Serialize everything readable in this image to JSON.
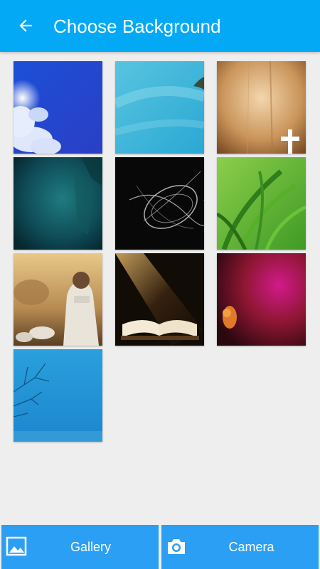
{
  "appbar": {
    "title": "Choose Background",
    "back_icon": "arrow-back-icon"
  },
  "backgrounds": [
    {
      "name": "background-blue-sky-clouds"
    },
    {
      "name": "background-turquoise-sky-bird"
    },
    {
      "name": "background-parchment-cross"
    },
    {
      "name": "background-teal-texture"
    },
    {
      "name": "background-black-light-swirls"
    },
    {
      "name": "background-green-grass"
    },
    {
      "name": "background-shepherd-painting"
    },
    {
      "name": "background-open-bible-light"
    },
    {
      "name": "background-magenta-red-texture"
    },
    {
      "name": "background-blue-tree"
    }
  ],
  "bottom_bar": {
    "gallery": {
      "label": "Gallery",
      "icon": "image-icon"
    },
    "camera": {
      "label": "Camera",
      "icon": "camera-icon"
    }
  },
  "colors": {
    "primary": "#03a9f4",
    "button": "#2b9ff3",
    "background": "#eeeeee"
  }
}
